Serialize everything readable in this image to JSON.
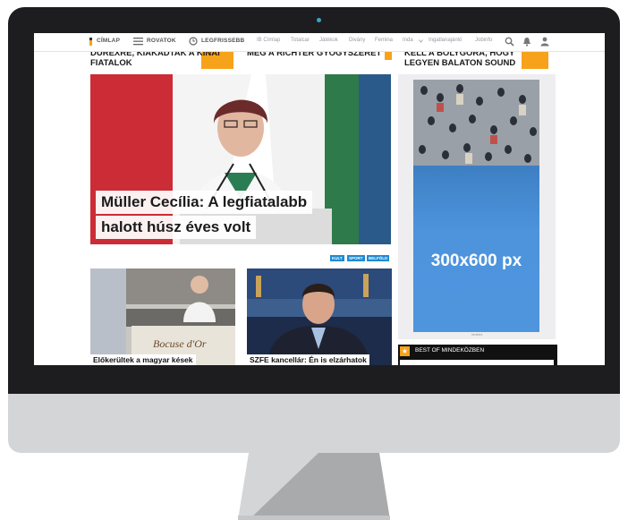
{
  "nav": {
    "home": "CÍMLAP",
    "sections": "ROVATOK",
    "latest": "LEGFRISSEBB",
    "links": [
      "IB Címlap",
      "Totalcar",
      "Játékok",
      "Divány",
      "Femina",
      "Inda",
      "Ingatlanajánló",
      "Jobinfo"
    ]
  },
  "headlines": {
    "top_left_1": "DUREXRE, KIAKADTAK A KÍNAI",
    "top_left_2": "FIATALOK",
    "top_mid": "MEG A RICHTER GYÓGYSZERÉT",
    "top_right_1": "KELL A BOLYGÓRA, HOGY",
    "top_right_2": "LEGYEN BALATON SOUND"
  },
  "hero": {
    "title_line1": "Müller Cecília: A legfiatalabb",
    "title_line2": "halott húsz éves volt"
  },
  "tags": [
    "KULT",
    "SPORT",
    "BELFÖLD"
  ],
  "thumbs": [
    {
      "caption": "Előkerültek a magyar kések",
      "plate": "Bocuse d'Or"
    },
    {
      "caption": "SZFE kancellár: Én is elzárhatok"
    }
  ],
  "ad": {
    "label": "300x600 px",
    "note": "hirdetés"
  },
  "best": {
    "label": "BEST OF MINDEKÖZBEN"
  },
  "colors": {
    "accent": "#f7a21b",
    "ad_blue": "#4e95de",
    "bezel": "#1d1d1f",
    "chin": "#d4d5d7",
    "tag_blue": "#1f8ad1"
  }
}
